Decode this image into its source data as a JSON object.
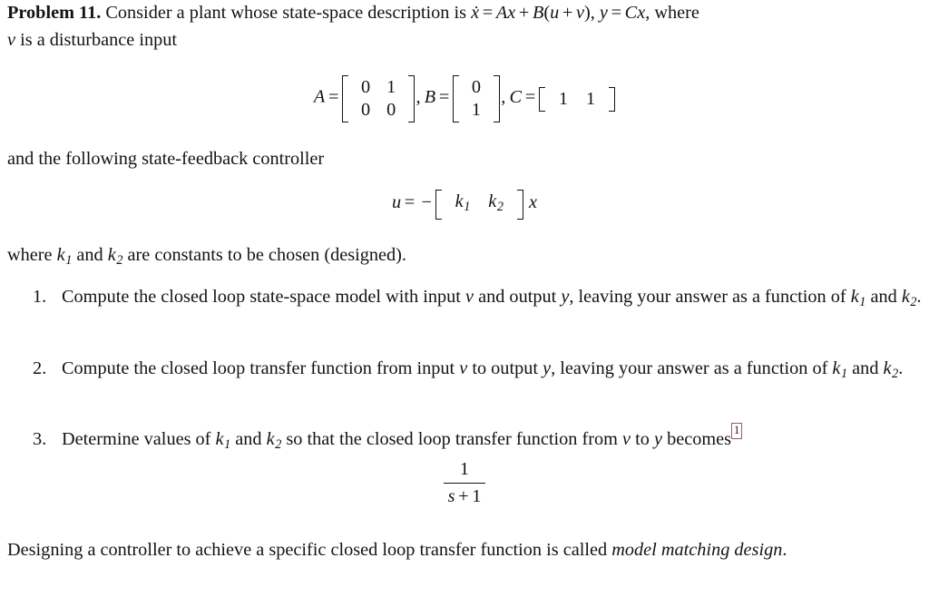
{
  "document": {
    "problem_label": "Problem 11.",
    "intro": {
      "text_before_eq": "Consider a plant whose state-space description is",
      "equation_inline": "ẋ = Ax + B(u + v), y = Cx",
      "text_after_eq": ", where",
      "line2": "v is a disturbance input"
    },
    "matrix_equation": {
      "A_label": "A",
      "A_rows": [
        [
          "0",
          "1"
        ],
        [
          "0",
          "0"
        ]
      ],
      "B_label": "B",
      "B_rows": [
        [
          "0"
        ],
        [
          "1"
        ]
      ],
      "C_label": "C",
      "C_rows": [
        [
          "1",
          "1"
        ]
      ],
      "equals": "=",
      "comma": ","
    },
    "controller_lead_in": "and the following state-feedback controller",
    "controller_equation": {
      "lhs": "u",
      "equals": "=",
      "minus": "−",
      "gain_row": [
        "k",
        "k"
      ],
      "gain_subscripts": [
        "1",
        "2"
      ],
      "state": "x"
    },
    "constants_note": {
      "prefix": "where",
      "k1": "k",
      "k1_sub": "1",
      "joiner": "and",
      "k2": "k",
      "k2_sub": "2",
      "suffix": "are constants to be chosen (designed)."
    },
    "items": [
      {
        "marker": "1.",
        "line1": "Compute the closed loop state-space model with input v and output y, leaving your answer as",
        "line2": "a function of k₁ and k₂.",
        "text_a": "Compute the closed loop state-space model with input",
        "var_v": "v",
        "text_b": "and output",
        "var_y": "y",
        "text_c": ", leaving your answer as a function of",
        "k1": "k",
        "k1_sub": "1",
        "joiner": "and",
        "k2": "k",
        "k2_sub": "2",
        "period": "."
      },
      {
        "marker": "2.",
        "text_a": "Compute the closed loop transfer function from input",
        "var_v": "v",
        "text_b": "to output",
        "var_y": "y",
        "text_c": ", leaving your answer as a function of",
        "k1": "k",
        "k1_sub": "1",
        "joiner": "and",
        "k2": "k",
        "k2_sub": "2",
        "period": "."
      },
      {
        "marker": "3.",
        "text_a": "Determine values of",
        "k1": "k",
        "k1_sub": "1",
        "joiner": "and",
        "k2": "k",
        "k2_sub": "2",
        "text_b": "so that the closed loop transfer function from",
        "var_v": "v",
        "text_c": "to",
        "var_y": "y",
        "text_d": "becomes",
        "footnote_marker": "1"
      }
    ],
    "transfer_function": {
      "numerator": "1",
      "denominator_s": "s",
      "denominator_op": "+",
      "denominator_one": "1"
    },
    "closing": {
      "text_a": "Designing a controller to achieve a specific closed loop transfer function is called",
      "emphasis": "model matching design",
      "period": "."
    }
  },
  "colors": {
    "text": "#131313",
    "page_background": "#ffffff",
    "footnote_link_box_border": "#9c5b53"
  }
}
